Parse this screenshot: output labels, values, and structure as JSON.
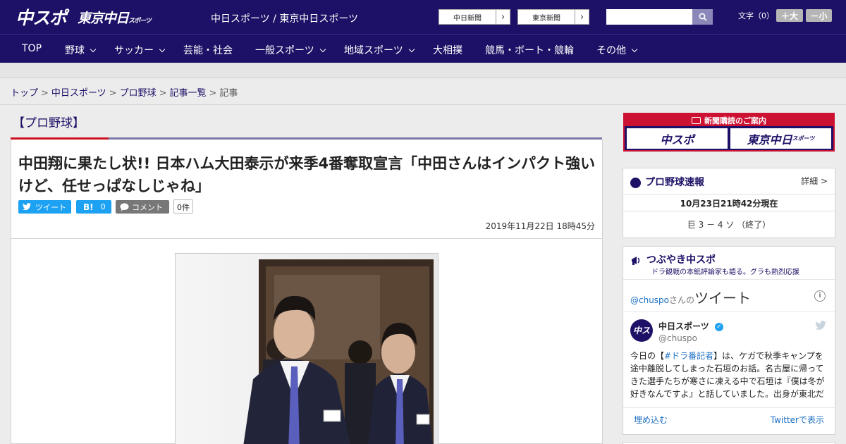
{
  "header": {
    "logo_chuspo": "中スポ",
    "logo_tokyo": "東京中日",
    "logo_tokyo_sub": "スポーツ",
    "site_link": "中日スポーツ / 東京中日スポーツ",
    "chunichi_button": "中日新聞",
    "tokyo_button": "東京新聞",
    "font_label": "文字（0）",
    "font_larger": "＋大",
    "font_smaller": "－小"
  },
  "nav": {
    "items": [
      {
        "label": "TOP"
      },
      {
        "label": "野球"
      },
      {
        "label": "サッカー"
      },
      {
        "label": "芸能・社会"
      },
      {
        "label": "一般スポーツ"
      },
      {
        "label": "地域スポーツ"
      },
      {
        "label": "大相撲"
      },
      {
        "label": "競馬・ボート・競輪"
      },
      {
        "label": "その他"
      }
    ]
  },
  "breadcrumb": {
    "items": [
      "トップ",
      "中日スポーツ",
      "プロ野球",
      "記事一覧"
    ],
    "current": "記事",
    "separator": ">"
  },
  "article": {
    "category": "【プロ野球】",
    "headline": "中田翔に果たし状!! 日本ハム大田泰示が来季4番奪取宣言「中田さんはインパクト強いけど、任せっぱなしじゃね」",
    "tweet_label": "ツイート",
    "hatena_label": "B!",
    "hatena_count": "0",
    "comment_label": "コメント",
    "comment_count": "0件",
    "date": "2019年11月22日 18時45分"
  },
  "sidebar": {
    "subscribe_header": "新聞購読のご案内",
    "subscribe_logo1": "中スポ",
    "subscribe_logo2": "東京中日",
    "subscribe_logo2_sub": "スポーツ",
    "baseball_title": "プロ野球速報",
    "baseball_detail": "詳細 >",
    "baseball_time": "10月23日21時42分現在",
    "baseball_score": "巨 3 － 4 ソ （終了）",
    "tsubuyaki_title": "つぶやき中スポ",
    "tsubuyaki_sub": "ドラ観戦の本紙評論家も語る。グラも熱烈応援",
    "twitter_handle": "@chuspo",
    "twitter_san": "さんの",
    "twitter_tweet": "ツイート",
    "account_name": "中日スポーツ",
    "account_handle": "@chuspo",
    "tweet_text_pre": "今日の【",
    "tweet_hashtag": "#ドラ番記者",
    "tweet_text_post": "】は、ケガで秋季キャンプを途中離脱してしまった石垣のお話。名古屋に帰ってきた選手たちが寒さに凍える中で石垣は『僕は冬が好きなんですよ』と話していました。出身が東北だ",
    "embed_label": "埋め込む",
    "view_on_twitter": "Twitterで表示"
  },
  "colors": {
    "brand_navy": "#1c1166",
    "accent_red": "#cc1122",
    "twitter_blue": "#1da1f2"
  }
}
